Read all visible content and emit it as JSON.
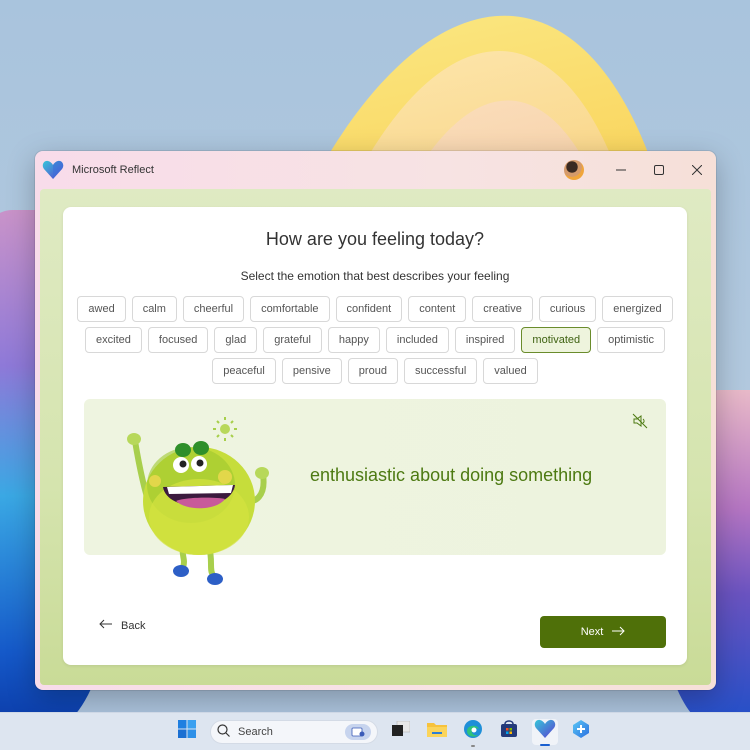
{
  "window": {
    "title": "Microsoft Reflect",
    "icons": {
      "app": "heart-logo-icon",
      "minimize": "minimize-icon",
      "maximize": "maximize-icon",
      "close": "close-icon"
    },
    "controls": {
      "minimize": "—",
      "maximize": "☐",
      "close": "✕"
    }
  },
  "main": {
    "heading": "How are you feeling today?",
    "subheading": "Select the emotion that best describes your feeling",
    "emotions": [
      [
        "awed",
        "calm",
        "cheerful",
        "comfortable",
        "confident",
        "content",
        "creative",
        "curious",
        "energized"
      ],
      [
        "excited",
        "focused",
        "glad",
        "grateful",
        "happy",
        "included",
        "inspired",
        "motivated",
        "optimistic"
      ],
      [
        "peaceful",
        "pensive",
        "proud",
        "successful",
        "valued"
      ]
    ],
    "selected_emotion": "motivated",
    "feature": {
      "description": "enthusiastic about doing something",
      "sound_icon": "speaker-muted-icon",
      "illustration": "green-monster-character"
    },
    "back_label": "Back",
    "next_label": "Next"
  },
  "colors": {
    "accent": "#4f7009",
    "selected_chip_bg": "#eef4dd",
    "feeling_text": "#4d7a12"
  },
  "taskbar": {
    "search_placeholder": "Search",
    "items": [
      "start-icon",
      "task-view-icon",
      "file-explorer-icon",
      "edge-icon",
      "store-icon",
      "reflect-icon",
      "copilot-icon"
    ],
    "active": "reflect-icon"
  }
}
